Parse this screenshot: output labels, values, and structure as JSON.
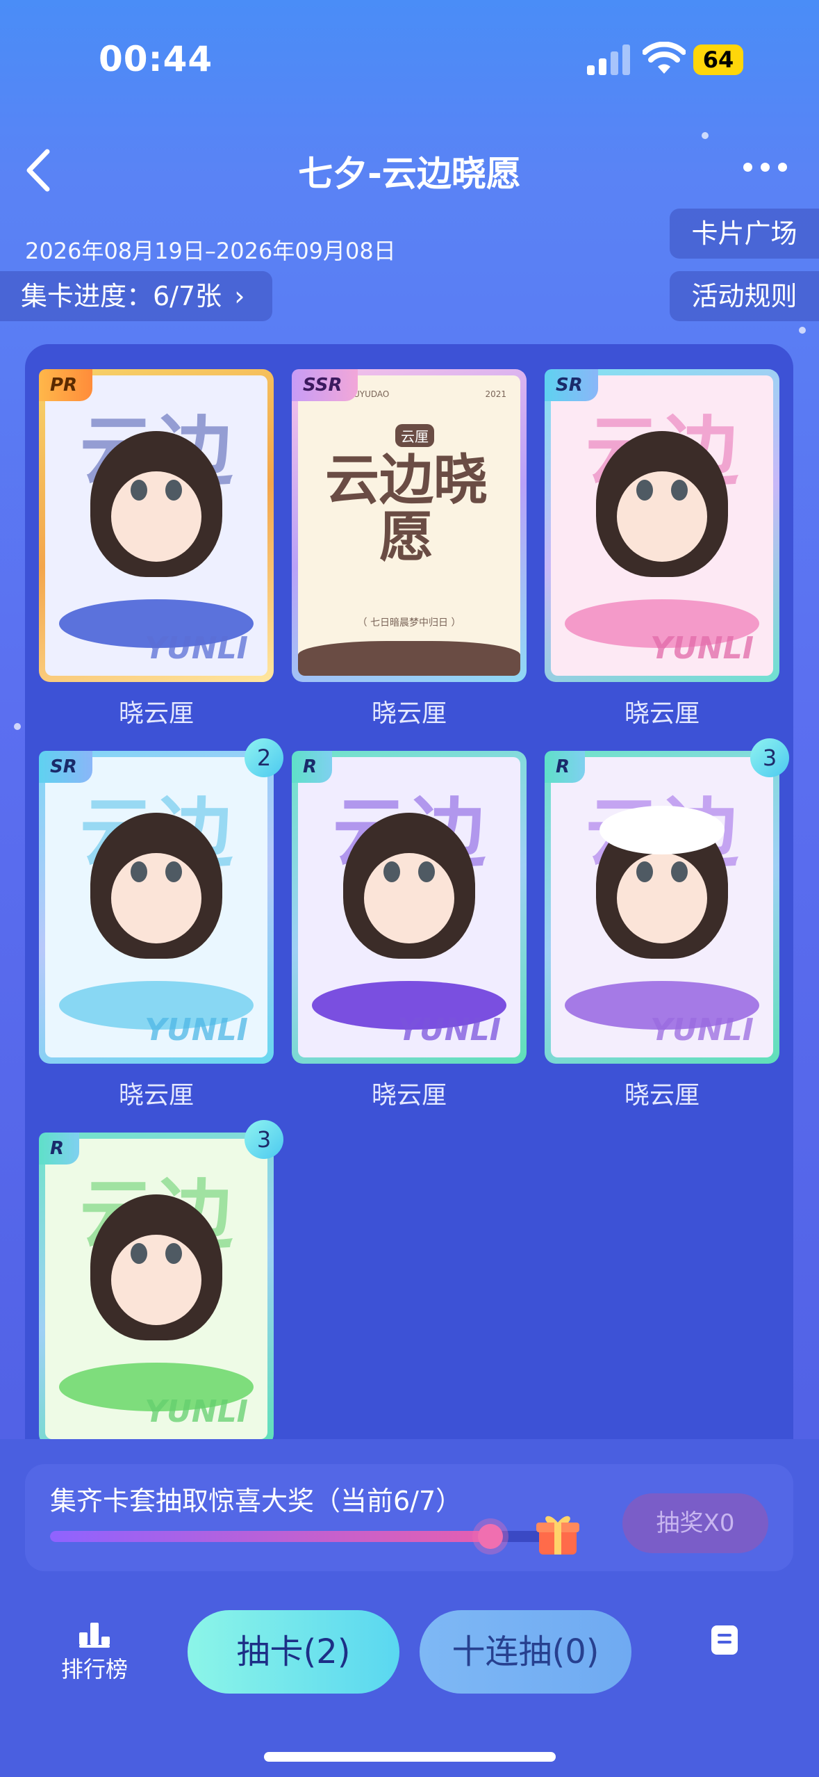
{
  "status": {
    "time": "00:44",
    "battery": "64"
  },
  "header": {
    "title": "七夕-云边晓愿",
    "date_range": "2026年08月19日–2026年09月08日"
  },
  "buttons": {
    "card_plaza": "卡片广场",
    "rules": "活动规则"
  },
  "progress": {
    "label": "集卡进度：6/7张",
    "chevron": "›"
  },
  "cards": [
    {
      "rarity": "PR",
      "name": "晓云厘",
      "count": "",
      "theme": "#f2c14e"
    },
    {
      "rarity": "SSR",
      "name": "晓云厘",
      "count": "",
      "theme": "#d9a7f5",
      "cover_title": "云边晓愿",
      "cover_tag": "云厘",
      "cover_top_left": "ALL FOR LUYUDAO",
      "cover_top_right": "2021",
      "cover_footer": "（ 七日暗晨梦中归日 ）"
    },
    {
      "rarity": "SR",
      "name": "晓云厘",
      "count": "",
      "theme": "#5fd6e8"
    },
    {
      "rarity": "SR",
      "name": "晓云厘",
      "count": "2",
      "theme": "#5fc6f0"
    },
    {
      "rarity": "R",
      "name": "晓云厘",
      "count": "",
      "theme": "#52d8c0"
    },
    {
      "rarity": "R",
      "name": "晓云厘",
      "count": "3",
      "theme": "#52d8c0"
    },
    {
      "rarity": "R",
      "name": "",
      "count": "3",
      "theme": "#52d8c0"
    }
  ],
  "card_art": {
    "big_text": "云边",
    "signature": "YUNLI"
  },
  "reward": {
    "text": "集齐卡套抽取惊喜大奖（当前6/7）",
    "progress": 0.857,
    "button": "抽奖X0"
  },
  "bottom_nav": {
    "rank": "排行榜",
    "draw_one": "抽卡(2)",
    "draw_ten": "十连抽(0)"
  },
  "colors": {
    "accent": "#5ad7f0",
    "gold": "#ffd60a"
  },
  "icons": [
    "back-icon",
    "more-icon",
    "signal-icon",
    "wifi-icon",
    "battery-icon",
    "gift-icon",
    "rank-icon",
    "document-icon"
  ]
}
